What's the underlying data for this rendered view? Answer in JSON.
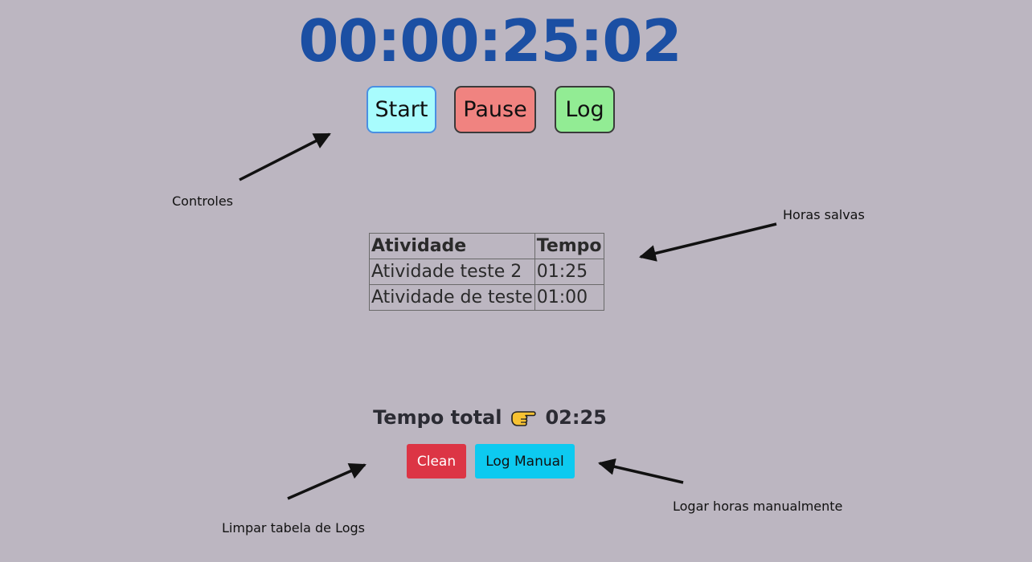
{
  "timer": {
    "display": "00:00:25:02"
  },
  "controls": {
    "start_label": "Start",
    "pause_label": "Pause",
    "log_label": "Log"
  },
  "annotations": {
    "controls": "Controles",
    "saved_hours": "Horas salvas",
    "clear_logs": "Limpar tabela de Logs",
    "manual_log": "Logar horas manualmente"
  },
  "log_table": {
    "headers": [
      "Atividade",
      "Tempo"
    ],
    "rows": [
      [
        "Atividade teste 2",
        "01:25"
      ],
      [
        "Atividade de teste",
        "01:00"
      ]
    ]
  },
  "total": {
    "label": "Tempo total",
    "value": "02:25",
    "icon": "pointing-hand-icon"
  },
  "actions": {
    "clean_label": "Clean",
    "manual_label": "Log Manual"
  },
  "colors": {
    "background": "#bcb6c1",
    "timer": "#1b4fa3",
    "start": "#a8fcfd",
    "pause": "#f08380",
    "log": "#92ec94",
    "clean": "#dc3545",
    "manual": "#0dcaf0"
  }
}
